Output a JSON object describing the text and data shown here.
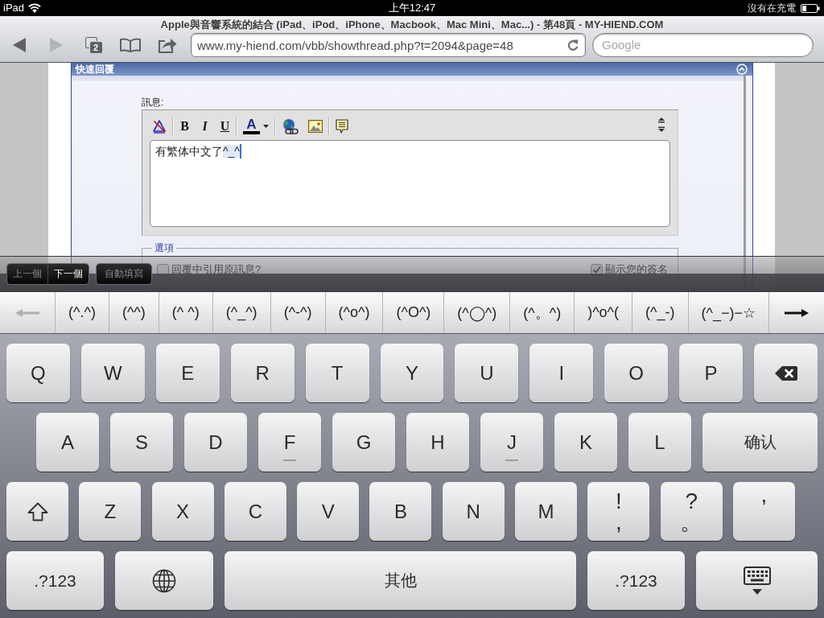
{
  "status_bar": {
    "carrier": "iPad",
    "time": "上午12:47",
    "battery_text": "沒有在充電"
  },
  "browser": {
    "title": "Apple與音響系統的結合 (iPad、iPod、iPhone、Macbook、Mac Mini、Mac...) - 第48頁 - MY-HIEND.COM",
    "toolbar_buttons": [
      {
        "kind": "back",
        "disabled": false
      },
      {
        "kind": "forward",
        "disabled": true
      },
      {
        "kind": "tabs",
        "count": "2"
      },
      {
        "kind": "bookmarks"
      },
      {
        "kind": "share"
      }
    ],
    "url": "www.my-hiend.com/vbb/showthread.php?t=2094&page=48",
    "search": {
      "placeholder": "Google"
    }
  },
  "page": {
    "panel_title": "快速回覆",
    "message_label": "訊息:",
    "editor_toolbar": [
      [
        {
          "kind": "clear_format"
        }
      ],
      [
        {
          "kind": "bold",
          "label": "B"
        },
        {
          "kind": "italic",
          "label": "I"
        },
        {
          "kind": "underline",
          "label": "U"
        }
      ],
      [
        {
          "kind": "font_color",
          "label": "A"
        }
      ],
      [
        {
          "kind": "link"
        },
        {
          "kind": "image"
        }
      ],
      [
        {
          "kind": "quote"
        }
      ]
    ],
    "message": {
      "text": "有繁体中文了",
      "marked_text": "^_^"
    },
    "options": {
      "legend": "選項",
      "checkboxes": [
        {
          "label": "回覆中引用原訊息?",
          "checked": false
        },
        {
          "label": "顯示您的簽名",
          "checked": true
        }
      ]
    }
  },
  "form_assistant": {
    "buttons": [
      {
        "kind": "previous",
        "label": "上一個",
        "disabled": true
      },
      {
        "kind": "next",
        "label": "下一個",
        "disabled": false
      },
      {
        "kind": "autofill",
        "label": "自動填寫",
        "disabled": true
      }
    ]
  },
  "candidate_bar": {
    "scroll_left": {
      "disabled": true
    },
    "candidates": [
      "(^.^)",
      "(^^)",
      "(^ ^)",
      "(^_^)",
      "(^-^)",
      "(^o^)",
      "(^O^)",
      "(^◯^)",
      "(^。^)",
      ")^o^(",
      "(^_-)",
      "(^_−)−☆"
    ],
    "scroll_right": {
      "disabled": false
    }
  },
  "keyboard": {
    "rows": [
      {
        "keys": [
          {
            "kind": "letter",
            "label": "Q",
            "home_marker": false
          },
          {
            "kind": "letter",
            "label": "W",
            "home_marker": false
          },
          {
            "kind": "letter",
            "label": "E",
            "home_marker": false
          },
          {
            "kind": "letter",
            "label": "R",
            "home_marker": false
          },
          {
            "kind": "letter",
            "label": "T",
            "home_marker": false
          },
          {
            "kind": "letter",
            "label": "Y",
            "home_marker": false
          },
          {
            "kind": "letter",
            "label": "U",
            "home_marker": false
          },
          {
            "kind": "letter",
            "label": "I",
            "home_marker": false
          },
          {
            "kind": "letter",
            "label": "O",
            "home_marker": false
          },
          {
            "kind": "letter",
            "label": "P",
            "home_marker": false
          },
          {
            "kind": "backspace"
          }
        ]
      },
      {
        "keys": [
          {
            "kind": "letter",
            "label": "A",
            "home_marker": false
          },
          {
            "kind": "letter",
            "label": "S",
            "home_marker": false
          },
          {
            "kind": "letter",
            "label": "D",
            "home_marker": false
          },
          {
            "kind": "letter",
            "label": "F",
            "home_marker": true
          },
          {
            "kind": "letter",
            "label": "G",
            "home_marker": false
          },
          {
            "kind": "letter",
            "label": "H",
            "home_marker": false
          },
          {
            "kind": "letter",
            "label": "J",
            "home_marker": true
          },
          {
            "kind": "letter",
            "label": "K",
            "home_marker": false
          },
          {
            "kind": "letter",
            "label": "L",
            "home_marker": false
          },
          {
            "kind": "enter",
            "label": "确认"
          }
        ]
      },
      {
        "keys": [
          {
            "kind": "shift"
          },
          {
            "kind": "letter",
            "label": "Z",
            "home_marker": false
          },
          {
            "kind": "letter",
            "label": "X",
            "home_marker": false
          },
          {
            "kind": "letter",
            "label": "C",
            "home_marker": false
          },
          {
            "kind": "letter",
            "label": "V",
            "home_marker": false
          },
          {
            "kind": "letter",
            "label": "B",
            "home_marker": false
          },
          {
            "kind": "letter",
            "label": "N",
            "home_marker": false
          },
          {
            "kind": "letter",
            "label": "M",
            "home_marker": false
          },
          {
            "kind": "dual",
            "top": "!",
            "bottom": ","
          },
          {
            "kind": "dual",
            "top": "?",
            "bottom": "。"
          },
          {
            "kind": "symbol",
            "label": "’"
          }
        ]
      },
      {
        "keys": [
          {
            "kind": "mode",
            "label": ".?123"
          },
          {
            "kind": "globe"
          },
          {
            "kind": "space",
            "label": "其他"
          },
          {
            "kind": "mode",
            "label": ".?123"
          },
          {
            "kind": "hide"
          }
        ]
      }
    ]
  }
}
